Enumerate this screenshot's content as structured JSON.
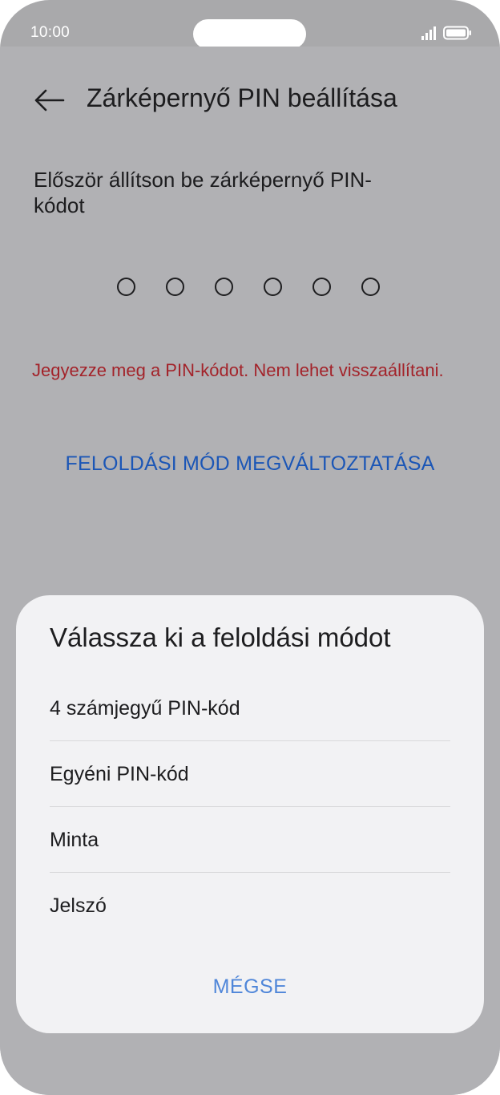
{
  "status_bar": {
    "time": "10:00",
    "signal_icon": "cellular-signal-icon",
    "battery_icon": "battery-icon"
  },
  "header": {
    "back_icon": "arrow-left-icon",
    "title": "Zárképernyő PIN beállítása"
  },
  "main": {
    "prompt": "Először állítson be zárképernyő PIN-kódot",
    "pin_length": 6,
    "warning": "Jegyezze meg a PIN-kódot. Nem lehet visszaállítani.",
    "change_mode_label": "FELOLDÁSI MÓD MEGVÁLTOZTATÁSA"
  },
  "sheet": {
    "title": "Válassza ki a feloldási módot",
    "options": [
      {
        "label": "4 számjegyű PIN-kód"
      },
      {
        "label": "Egyéni PIN-kód"
      },
      {
        "label": "Minta"
      },
      {
        "label": "Jelszó"
      }
    ],
    "cancel_label": "MÉGSE"
  },
  "colors": {
    "warning": "#a3232a",
    "link": "#1b56b6",
    "cancel": "#4f86d9",
    "sheet_background": "#f2f2f4",
    "dimmed_background": "#b1b1b4"
  }
}
